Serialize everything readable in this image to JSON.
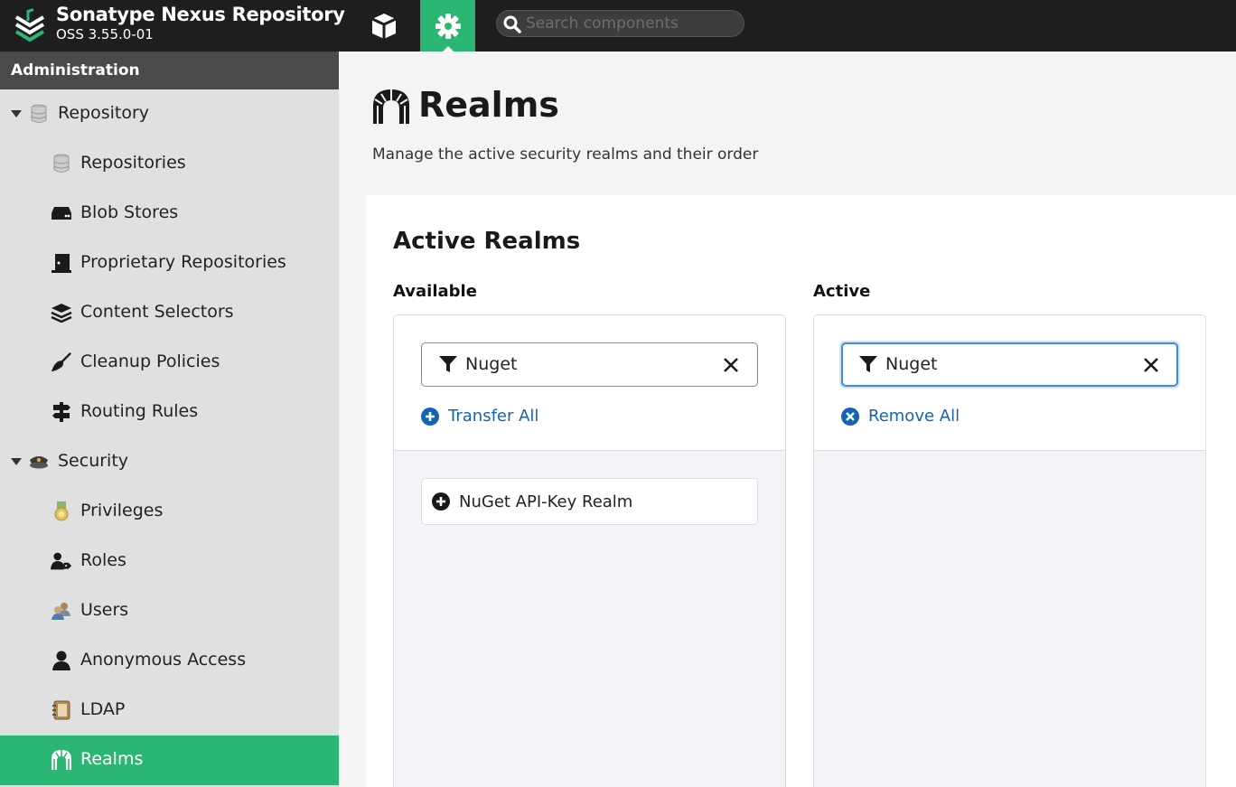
{
  "header": {
    "title": "Sonatype Nexus Repository",
    "version": "OSS 3.55.0-01",
    "search_placeholder": "Search components",
    "icons": {
      "logo": "nexus-logo",
      "browse": "cube-icon",
      "admin": "gear-icon",
      "search": "search-icon"
    },
    "colors": {
      "bar": "#1e1e1e",
      "accent": "#2bb673"
    }
  },
  "sidebar": {
    "heading": "Administration",
    "items": [
      {
        "label": "Repository",
        "icon": "database-icon",
        "level": "group"
      },
      {
        "label": "Repositories",
        "icon": "database-icon",
        "level": "child"
      },
      {
        "label": "Blob Stores",
        "icon": "hard-drive-icon",
        "level": "child"
      },
      {
        "label": "Proprietary Repositories",
        "icon": "door-icon",
        "level": "child"
      },
      {
        "label": "Content Selectors",
        "icon": "layers-icon",
        "level": "child"
      },
      {
        "label": "Cleanup Policies",
        "icon": "broom-icon",
        "level": "child"
      },
      {
        "label": "Routing Rules",
        "icon": "signpost-icon",
        "level": "child"
      },
      {
        "label": "Security",
        "icon": "police-hat-icon",
        "level": "group"
      },
      {
        "label": "Privileges",
        "icon": "medal-icon",
        "level": "child"
      },
      {
        "label": "Roles",
        "icon": "user-tag-icon",
        "level": "child"
      },
      {
        "label": "Users",
        "icon": "users-icon",
        "level": "child"
      },
      {
        "label": "Anonymous Access",
        "icon": "user-icon",
        "level": "child"
      },
      {
        "label": "LDAP",
        "icon": "address-book-icon",
        "level": "child"
      },
      {
        "label": "Realms",
        "icon": "archway-icon",
        "level": "child",
        "active": true
      }
    ]
  },
  "main": {
    "title": "Realms",
    "title_icon": "archway-icon",
    "description": "Manage the active security realms and their order",
    "card": {
      "title": "Active Realms",
      "available": {
        "label": "Available",
        "filter_value": "Nuget",
        "action_label": "Transfer All",
        "items": [
          "NuGet API-Key Realm"
        ]
      },
      "active": {
        "label": "Active",
        "filter_value": "Nuget",
        "action_label": "Remove All",
        "items": []
      }
    }
  }
}
